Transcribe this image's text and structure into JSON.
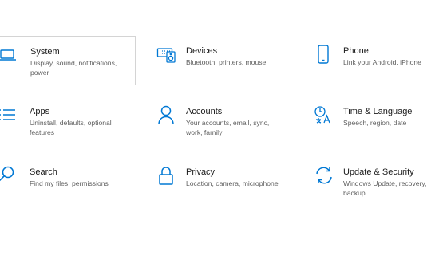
{
  "accent": "#0078d4",
  "tiles": [
    {
      "name": "System",
      "desc": "Display, sound, notifications, power",
      "icon": "laptop-icon"
    },
    {
      "name": "Devices",
      "desc": "Bluetooth, printers, mouse",
      "icon": "keyboard-speaker-icon"
    },
    {
      "name": "Phone",
      "desc": "Link your Android, iPhone",
      "icon": "phone-icon"
    },
    {
      "name": "Apps",
      "desc": "Uninstall, defaults, optional features",
      "icon": "apps-list-icon"
    },
    {
      "name": "Accounts",
      "desc": "Your accounts, email, sync, work, family",
      "icon": "person-icon"
    },
    {
      "name": "Time & Language",
      "desc": "Speech, region, date",
      "icon": "time-language-icon"
    },
    {
      "name": "Search",
      "desc": "Find my files, permissions",
      "icon": "search-icon"
    },
    {
      "name": "Privacy",
      "desc": "Location, camera, microphone",
      "icon": "lock-icon"
    },
    {
      "name": "Update & Security",
      "desc": "Windows Update, recovery, backup",
      "icon": "sync-icon"
    }
  ]
}
